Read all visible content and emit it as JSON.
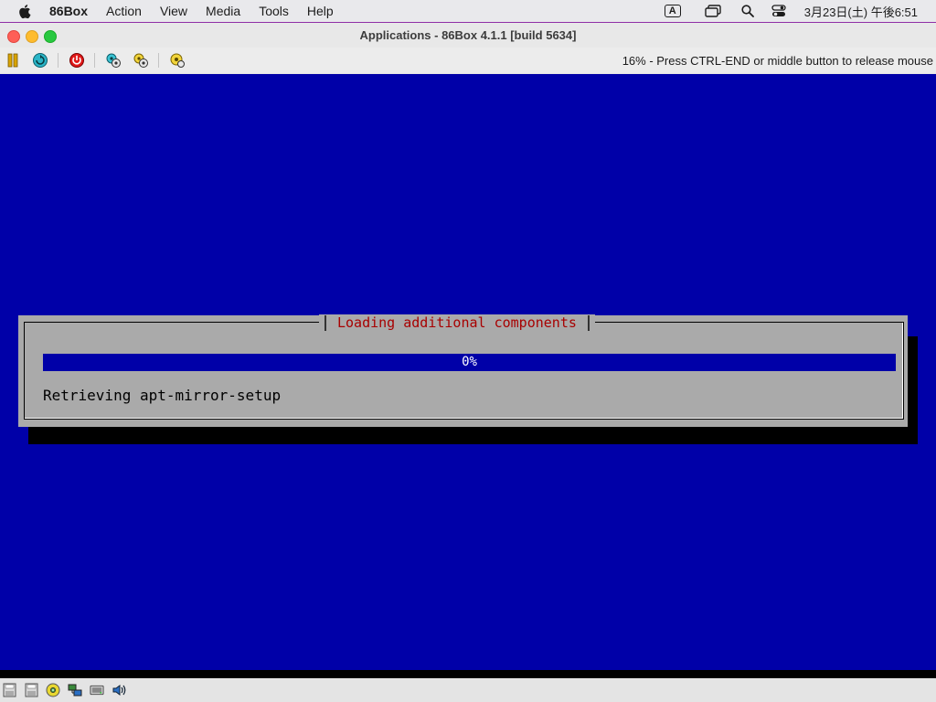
{
  "menubar": {
    "app_name": "86Box",
    "items": [
      "Action",
      "View",
      "Media",
      "Tools",
      "Help"
    ],
    "input_source": "A",
    "clock": "3月23日(土) 午後6:51"
  },
  "window": {
    "title": "Applications - 86Box 4.1.1 [build 5634]"
  },
  "toolbar": {
    "status_message": "16% - Press CTRL-END or middle button to release mouse",
    "buttons": [
      "pause-icon",
      "ctrl-alt-del-icon",
      "hard-reset-icon",
      "settings-icon",
      "take-screenshot-icon",
      "sound-gain-icon"
    ]
  },
  "dialog": {
    "title": "Loading additional components",
    "progress_text": "0%",
    "progress_fraction": 0,
    "message": "Retrieving apt-mirror-setup"
  },
  "statusbar": {
    "icons": [
      "floppy-a-icon",
      "floppy-b-icon",
      "cdrom-icon",
      "network-icon",
      "hard-disk-icon",
      "sound-icon"
    ]
  },
  "colors": {
    "screen_bg": "#0000a8",
    "dialog_bg": "#aaaaaa",
    "dialog_title": "#a80000"
  }
}
